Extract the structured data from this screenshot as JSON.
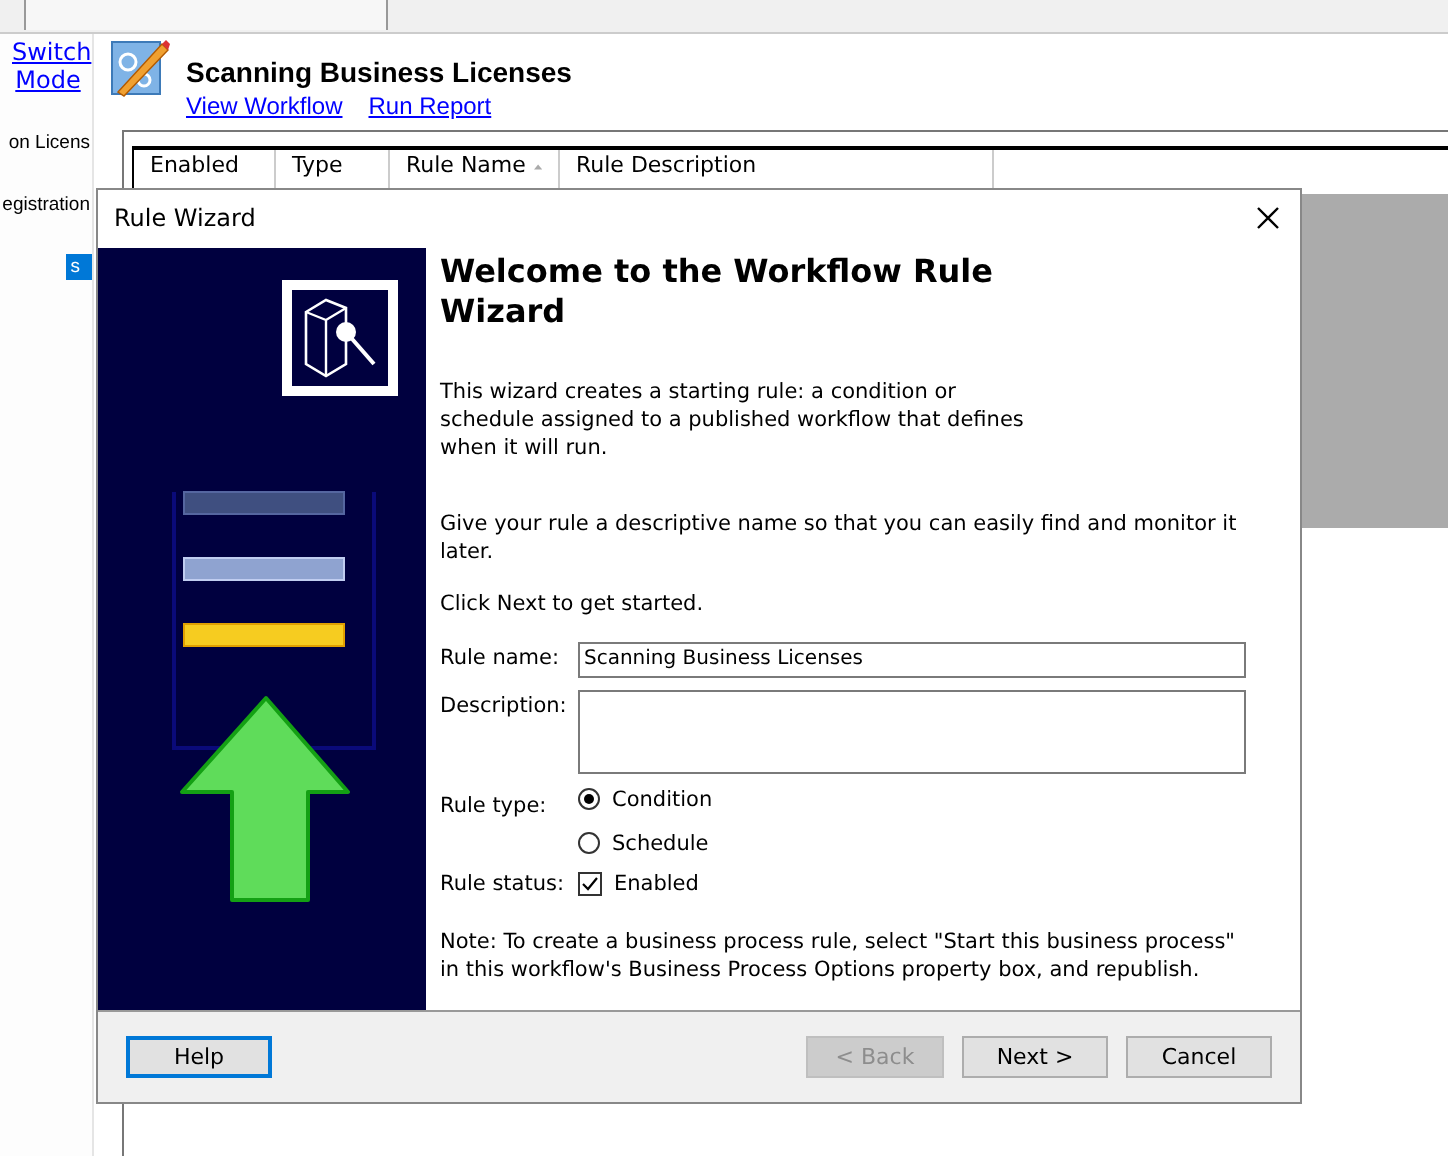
{
  "sidebar": {
    "link": "Switch Mode",
    "items": [
      {
        "label": "on Licens",
        "selected": false
      },
      {
        "label": "egistration",
        "selected": false
      },
      {
        "label": "s",
        "selected": true
      }
    ]
  },
  "header": {
    "title": "Scanning Business Licenses",
    "links": [
      "View Workflow",
      "Run Report"
    ]
  },
  "table": {
    "columns": [
      "Enabled",
      "Type",
      "Rule Name",
      "Rule Description"
    ]
  },
  "dialog": {
    "title": "Rule Wizard",
    "heading": "Welcome to the Workflow Rule Wizard",
    "intro": "This wizard creates a starting rule: a condition or schedule assigned to a published workflow that defines when it will run.",
    "hint": "Give your rule a descriptive name so that you can easily find and monitor it later.",
    "start": "Click Next to get started.",
    "rule_name": {
      "label": "Rule name:",
      "value": "Scanning Business Licenses"
    },
    "description": {
      "label": "Description:"
    },
    "rule_type": {
      "label": "Rule type:",
      "options": [
        {
          "label": "Condition",
          "selected": true
        },
        {
          "label": "Schedule",
          "selected": false
        }
      ]
    },
    "rule_status": {
      "label": "Rule status:",
      "option": "Enabled",
      "checked": true
    },
    "note": "Note: To create a business process rule, select \"Start this business process\" in this workflow's Business Process Options property box, and republish.",
    "buttons": [
      {
        "label": "Help",
        "kind": "help",
        "disabled": false
      },
      {
        "label": "< Back",
        "kind": "nav",
        "disabled": true
      },
      {
        "label": "Next >",
        "kind": "nav",
        "disabled": false
      },
      {
        "label": "Cancel",
        "kind": "nav",
        "disabled": false
      }
    ]
  }
}
